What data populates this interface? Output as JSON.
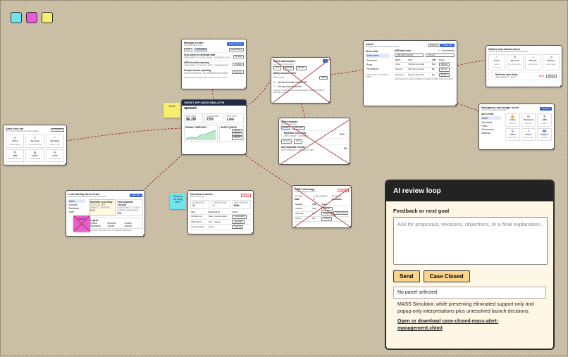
{
  "swatches": {
    "colors": [
      "#6fe3ee",
      "#e85bd6",
      "#f6ee6e"
    ]
  },
  "edge_color": "#a53b36",
  "alert_icon_set": {
    "title": "Alert icon set",
    "subtitle": "Alert icons and what each action enables",
    "button": "Component",
    "tiles": [
      {
        "icon": "warning-icon",
        "glyph": "⚠",
        "label": "Active",
        "sub": "CHANGE ALERT"
      },
      {
        "icon": "pause-icon",
        "glyph": "⏸",
        "label": "Snoozed",
        "sub": "RETURNS LATER"
      },
      {
        "icon": "check-icon",
        "glyph": "✓",
        "label": "Resolved",
        "sub": "CASE CLOSED"
      },
      {
        "icon": "send-icon",
        "glyph": "✉",
        "label": "ARR",
        "sub": "REVENUE IMPACT"
      },
      {
        "icon": "admin-icon",
        "glyph": "♟",
        "label": "Admin",
        "sub": "PERMISSIONS"
      },
      {
        "icon": "audit-icon",
        "glyph": "☰",
        "label": "Audit",
        "sub": "HISTORY SHIFT"
      }
    ]
  },
  "manage_center": {
    "title": "Manage center",
    "subtitle": "Customize alert center",
    "button": "Explore website",
    "tabs": [
      "Inbox",
      "Dismissed"
    ],
    "filter": "Last 30 days",
    "items": [
      {
        "title": "Sync delay on Northstar data",
        "sub": "ASSIGNED TO DATA TEAM · EXPIRES IN 2H",
        "action": "Review"
      },
      {
        "title": "ARR threshold warning",
        "sub": "ASSIGNED TO SALES OPS · OWNERSHIP",
        "action": "Replace"
      },
      {
        "title": "Delayed launch reporting",
        "sub": "INVESTIGATING · NO OWNER ASSIGNED",
        "action": "Reassign"
      }
    ],
    "footer": "Northstar alert settings to be sent in the next 24 hours"
  },
  "target_app": {
    "title": "TARGET APP: MASS SIMULATOR",
    "headline": "upward.",
    "metrics": [
      {
        "label": "ARR ($M)",
        "value": "$8.2M"
      },
      {
        "label": "Engagement",
        "value": "73%"
      },
      {
        "label": "Risk level",
        "value": "Low"
      }
    ],
    "forecast_label": "SIGNAL FORECAST",
    "queue_label": "ALERT QUEUE",
    "buttons": [
      "Dismiss",
      "Snooze",
      "Dismiss"
    ]
  },
  "note_this_is": {
    "text": "This is"
  },
  "dashboard": {
    "title": "Alert dashboard",
    "subtitle": "Live view of critical alerts",
    "tabs": [
      "Live",
      "Settings",
      "Launch"
    ],
    "filters": [
      "Notify account owner",
      "Alert owner"
    ],
    "field": "$10k",
    "checks": [
      "Include Northstar critical ARR",
      "List reporting thresholds"
    ],
    "footer": "Preview: 2 critical alerts exceed $10k ARR. Dashboard reflects alert after 24 hours"
  },
  "alerts_panel": {
    "title": "Alerts",
    "subtitle": "Manage settings and review alerts queue",
    "buttons": [
      "Export log",
      "Create alert"
    ],
    "sidebar": [
      "Alert center",
      "Active alerts",
      "Dismissed",
      "Rules",
      "Permissions"
    ],
    "sidebar_note": "ALERTS ONLY CUSTOMERS VISIBLE",
    "alert_rules_label": "ARR alert rules",
    "toggle_label": "Auto dismiss",
    "selects": [
      "$10k ARR impacted",
      "24 hours"
    ],
    "col_headers": [
      "Status",
      "Alert",
      "ARR",
      "Action"
    ],
    "rows": [
      {
        "status": "Active",
        "alert": "Northstar sync delay",
        "arr": "$12k",
        "action": "Dismiss"
      },
      {
        "status": "Snoozed",
        "alert": "High churn accounts",
        "arr": "$9k",
        "action": "Snooze"
      },
      {
        "status": "Dismissed",
        "alert": "Regional launch risk",
        "arr": "$4k",
        "action": "Restore"
      }
    ],
    "footer": "Dismissed items remain available and logged in ARR impact summaries"
  },
  "status_icons": {
    "title": "Status and action icons",
    "subtitle": "The alert icons themselves and their ARR impact",
    "tiles": [
      {
        "icon": "active-icon",
        "glyph": "⚠",
        "label": "Active",
        "sub": "NEEDS ATTENTION"
      },
      {
        "icon": "snooze-icon",
        "glyph": "⏱",
        "label": "Snoozed",
        "sub": "RETURNS LATER"
      },
      {
        "icon": "dismiss-icon",
        "glyph": "✓",
        "label": "Dismiss",
        "sub": "ARR HIDDEN"
      },
      {
        "icon": "restore-icon",
        "glyph": "↺",
        "label": "Restore",
        "sub": "BRING BACK"
      }
    ],
    "row_title": "Northstar sync delay",
    "row_sub": "ARR IMPACT · $12k",
    "row_value": "$12k",
    "row_button": "Dismiss"
  },
  "nav_icons": {
    "title": "Navigation and badge icons",
    "subtitle": "Icons for navigation and badges",
    "button": "Open set",
    "nav_label": "Alert center",
    "nav_items": [
      "Active",
      "Dismissed",
      "Rules",
      "Permissions",
      "Audit log"
    ],
    "tiles": [
      {
        "icon": "bell-icon",
        "glyph": "🔔",
        "label": "Active",
        "sub": "BADGE 3"
      },
      {
        "icon": "archive-icon",
        "glyph": "⊟",
        "label": "Dismissed",
        "sub": "ARCHIVE"
      },
      {
        "icon": "arr-icon",
        "glyph": "$",
        "label": "ARR",
        "sub": "IMPACT"
      },
      {
        "icon": "admin-shield-icon",
        "glyph": "⛨",
        "label": "Admin",
        "sub": "ROLE GATE"
      },
      {
        "icon": "export-icon",
        "glyph": "⇪",
        "label": "Export",
        "sub": "AUDIT LOG"
      },
      {
        "icon": "support-icon",
        "glyph": "☎",
        "label": "Support",
        "sub": "CONTACT"
      }
    ]
  },
  "alert_drawer": {
    "title": "Alert drawer",
    "subtitle": "Quick alert preview",
    "tabs": [
      "Active",
      "Dismissed"
    ],
    "item_title": "Northstar sync delay",
    "item_sub": "ARR impact · Data team",
    "item_value": "$12k",
    "buttons": [
      "Dismiss",
      "Open"
    ],
    "second_title": "New duplicate records",
    "second_sub": "ARR impacted · Updated 2h ago",
    "second_value": "$5k"
  },
  "low_alert_center": {
    "title": "Low-fidelity alert center",
    "subtitle": "Explore the core interactions in the alert center",
    "button": "Open view",
    "sidebar": [
      "Active",
      "Snoozed",
      "Dismissed",
      "Audit"
    ],
    "cards": [
      {
        "title": "Northstar sync delay",
        "sub": "CRITICAL ARR IMPACT · EXPIRES",
        "value": "$12k"
      },
      {
        "title": "New duplicate records",
        "sub": "ASSIGNED TO DATA · NEEDS GUIDANCE",
        "value": "$5k"
      }
    ],
    "legend_title": "Legend",
    "legend": [
      "Critical",
      "Snoozed",
      "Low/ok",
      "Dismissed",
      "Closed",
      "Launch"
    ],
    "footer": "Move more risky cases into the ARR alert dashboard",
    "pink_note": "Tool ok"
  },
  "note_what_doing": {
    "text": "What are we doing here?"
  },
  "dismissed_alerts": {
    "title": "Dismissed alerts",
    "subtitle": "Review audit log",
    "badge": "History",
    "metrics": [
      {
        "label": "DISMISSED",
        "value": "12"
      },
      {
        "label": "OWNERSHIP",
        "value": "4"
      },
      {
        "label": "ARR HIDDEN",
        "value": "$38k"
      }
    ],
    "col_headers": [
      "Alert",
      "Dismissed by",
      "Action"
    ],
    "rows": [
      {
        "alert": "Northstar sync",
        "by": "Maya · customer admin",
        "action": "Undo/restore"
      },
      {
        "alert": "CRM warning",
        "by": "Harv · manager",
        "action": "Add CRM"
      },
      {
        "alert": "Launch reminder",
        "by": "System",
        "action": "View log"
      }
    ]
  },
  "arr_triage": {
    "title": "ARR risk triage",
    "subtitle": "Prioritize flagged accounts",
    "badge": "Escalate",
    "metrics": [
      {
        "label": "AT RISK",
        "value": "$18k"
      },
      {
        "label": "CUSTOMERS",
        "value": "2"
      },
      {
        "label": "EXPIRES",
        "value": "3 months"
      }
    ],
    "col_headers": [
      "Account",
      "ARR",
      "Action"
    ],
    "rows": [
      {
        "account": "Northstar",
        "arr": "$12k",
        "action": "Dismiss"
      },
      {
        "account": "Helix Labs",
        "arr": "$4k",
        "action": "Assign CSM"
      },
      {
        "account": "Orbit Co",
        "arr": "$2k",
        "action": "Snooze"
      }
    ],
    "open_label": "Open review"
  },
  "review": {
    "title": "AI review loop",
    "feedback_label": "Feedback or next goal",
    "placeholder": "Ask for proposals, revisions, objections, or a final explanation.",
    "send_label": "Send",
    "close_label": "Case Closed",
    "status": "No panel selected.",
    "log_text": "MASS Simulator, while preserving eliminated support-only and popup-only interpretations plus unresolved launch decisions.",
    "link_text": "Open or download case-closed-mass-alert-management.xhtml"
  }
}
